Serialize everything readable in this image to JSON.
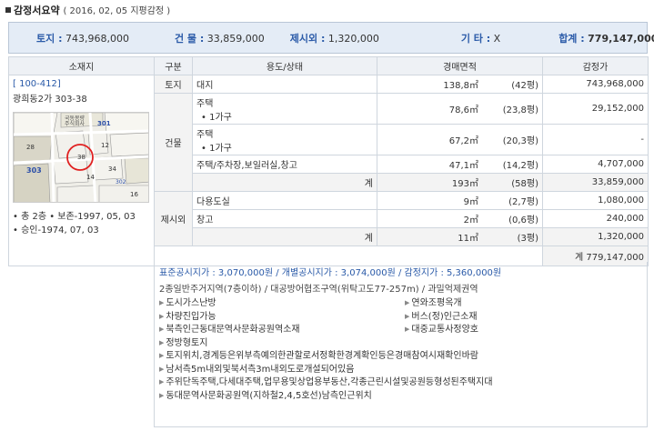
{
  "header": {
    "title": "감정서요약",
    "date_note": "( 2016, 02, 05  지평감정 )"
  },
  "summary": {
    "land_label": "토지 :",
    "land_value": "743,968,000",
    "building_label": "건 물 :",
    "building_value": "33,859,000",
    "excluded_label": "제시외 :",
    "excluded_value": "1,320,000",
    "other_label": "기 타 :",
    "other_value": "X",
    "total_label": "합계 :",
    "total_value": "779,147,000"
  },
  "table": {
    "headers": [
      "소재지",
      "구분",
      "용도/상태",
      "경매면적",
      "감정가"
    ],
    "location": {
      "code": "[ 100-412]",
      "address": "광희동2가 303-38",
      "notes": [
        "• 총 2층   • 보존-1997, 05, 03",
        "• 승인-1974, 07, 03"
      ],
      "map_labels": [
        "국동몽량",
        "주식회사",
        "301",
        "303",
        "38",
        "28",
        "12",
        "34",
        "14",
        "16",
        "302"
      ]
    },
    "land": {
      "category": "토지",
      "use": "대지",
      "area": "138,8㎡",
      "pyeong": "(42평)",
      "price": "743,968,000"
    },
    "building": {
      "category": "건물",
      "rows": [
        {
          "use": "주택",
          "sub": "• 1가구",
          "area": "78,6㎡",
          "pyeong": "(23,8평)",
          "price": "29,152,000"
        },
        {
          "use": "주택",
          "sub": "• 1가구",
          "area": "67,2㎡",
          "pyeong": "(20,3평)",
          "price": "-"
        },
        {
          "use": "주택/주차장,보일러실,창고",
          "sub": "",
          "area": "47,1㎡",
          "pyeong": "(14,2평)",
          "price": "4,707,000"
        }
      ],
      "subtotal": {
        "label": "계",
        "area": "193㎡",
        "pyeong": "(58평)",
        "price": "33,859,000"
      }
    },
    "excluded": {
      "category": "제시외",
      "rows": [
        {
          "use": "다용도실",
          "area": "9㎡",
          "pyeong": "(2,7평)",
          "price": "1,080,000"
        },
        {
          "use": "창고",
          "area": "2㎡",
          "pyeong": "(0,6평)",
          "price": "240,000"
        }
      ],
      "subtotal": {
        "label": "계",
        "area": "11㎡",
        "pyeong": "(3평)",
        "price": "1,320,000"
      }
    },
    "grand_total": "계  779,147,000"
  },
  "bottom": {
    "line1": "표준공시지가 : 3,070,000원 / 개별공시지가 : 3,074,000원 / 감정지가 : 5,360,000원",
    "line2": "2종일반주거지역(7층이하) / 대공방어협조구역(위탁고도77-257m) / 과밀억제권역",
    "grid": [
      "도시가스난방",
      "연와조평옥개",
      "차량진입가능",
      "버스(정)인근소재",
      "북측인근동대문역사문화공원역소재",
      "대중교통사정양호",
      "정방형토지"
    ],
    "full": [
      "토지위치,경계등은위부측예의한관할로서정확한경계확인등은경매참여시재확인바람",
      "남서측5m내외및북서측3m내외도로개설되어있음",
      "주위단독주택,다세대주택,업무용및상업용부동산,각종근린시설및공원등형성된주택지대",
      "동대문역사문화공원역(지하철2,4,5호선)남측인근위치"
    ]
  }
}
